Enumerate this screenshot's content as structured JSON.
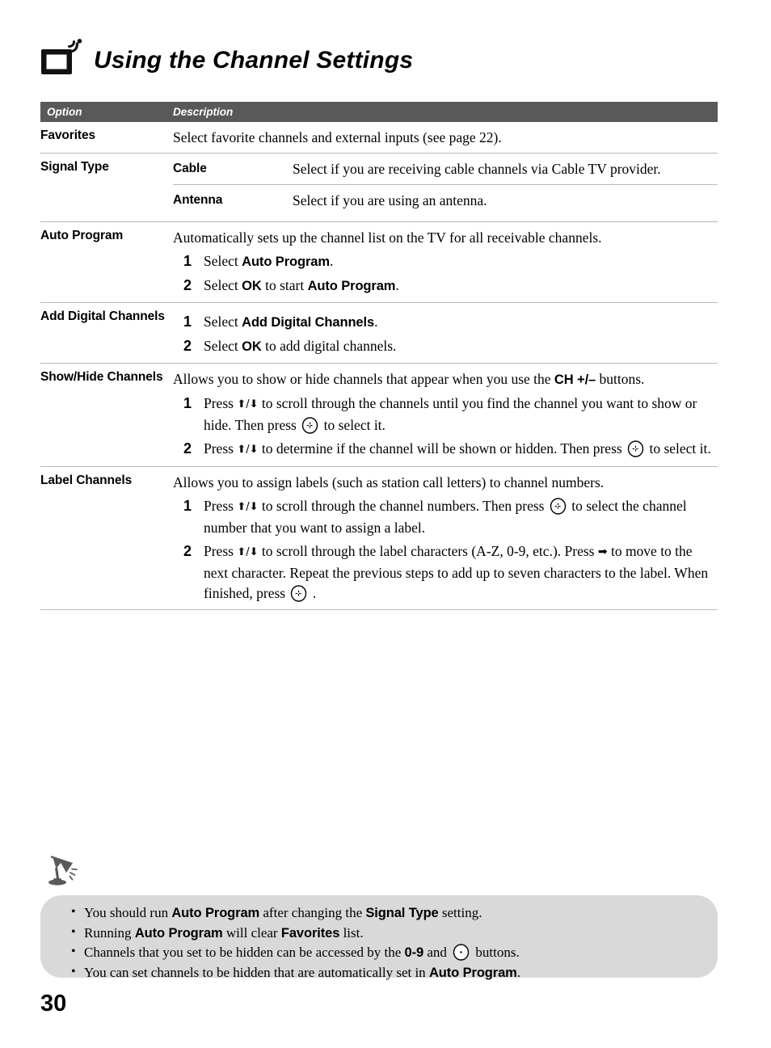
{
  "header": {
    "icon": "tv-signal-icon",
    "title": "Using the Channel Settings"
  },
  "table": {
    "columns": {
      "option": "Option",
      "description": "Description"
    },
    "rows": [
      {
        "option": "Favorites",
        "description": "Select favorite channels and external inputs (see page 22)."
      },
      {
        "option": "Signal Type",
        "subrows": [
          {
            "label": "Cable",
            "description": "Select if you are receiving cable channels via Cable TV provider."
          },
          {
            "label": "Antenna",
            "description": "Select if you are using an antenna."
          }
        ]
      },
      {
        "option": "Auto Program",
        "lead": "Automatically sets up the channel list on the TV for all receivable channels.",
        "steps": [
          {
            "num": "1",
            "text_a": "Select ",
            "bold_a": "Auto Program",
            "text_b": "."
          },
          {
            "num": "2",
            "text_a": "Select ",
            "bold_a": "OK",
            "text_b": " to start ",
            "bold_b": "Auto Program",
            "text_c": "."
          }
        ]
      },
      {
        "option": "Add Digital Channels",
        "steps": [
          {
            "num": "1",
            "text_a": "Select ",
            "bold_a": "Add Digital Channels",
            "text_b": "."
          },
          {
            "num": "2",
            "text_a": "Select ",
            "bold_a": "OK",
            "text_b": " to add digital channels."
          }
        ]
      },
      {
        "option": "Show/Hide Channels",
        "lead_a": "Allows you to show or hide channels that appear when you use the ",
        "lead_bold": "CH +/–",
        "lead_b": " buttons.",
        "steps": [
          {
            "num": "1",
            "seg1": "Press ",
            "arrows": "⬆/⬇",
            "seg2": " to scroll through the channels until you find the channel you want to show or hide. Then press ",
            "icon": "select-button-icon",
            "seg3": " to select it."
          },
          {
            "num": "2",
            "seg1": "Press ",
            "arrows": "⬆/⬇",
            "seg2": " to determine if the channel will be shown or hidden. Then press ",
            "icon": "select-button-icon",
            "seg3": " to select it."
          }
        ]
      },
      {
        "option": "Label Channels",
        "lead": "Allows you to assign labels (such as station call letters) to channel numbers.",
        "steps": [
          {
            "num": "1",
            "seg1": "Press ",
            "arrows": "⬆/⬇",
            "seg2": " to scroll through the channel numbers. Then press ",
            "icon": "select-button-icon",
            "seg3": " to select the channel number that you want to assign a label."
          },
          {
            "num": "2",
            "seg1": "Press ",
            "arrows": "⬆/⬇",
            "seg2": " to scroll through the label characters (A-Z, 0-9, etc.). Press ",
            "arrow_right": "➡",
            "seg3": " to move to the next character. Repeat the previous steps to add up to seven characters to the label. When finished, press ",
            "icon": "select-button-icon",
            "seg4": " ."
          }
        ]
      }
    ]
  },
  "notes": {
    "icon": "desk-lamp-tip-icon",
    "background_color": "#d9d9d9",
    "items": [
      {
        "seg1": "You should run ",
        "bold1": "Auto Program",
        "seg2": " after changing the ",
        "bold2": "Signal Type",
        "seg3": " setting."
      },
      {
        "seg1": "Running ",
        "bold1": "Auto Program",
        "seg2": " will clear ",
        "bold2": "Favorites",
        "seg3": " list."
      },
      {
        "seg1": "Channels that you set to be hidden can be accessed by the ",
        "bold1": "0-9",
        "seg2": " and ",
        "icon": "dot-button-icon",
        "seg3": " buttons."
      },
      {
        "seg1": "You can set channels to be hidden that are automatically set in ",
        "bold1": "Auto Program",
        "seg2": "."
      }
    ]
  },
  "footer": {
    "page_number": "30"
  },
  "colors": {
    "table_header_bg": "#59595b",
    "table_header_text": "#ffffff",
    "rule": "#b9b9b9",
    "notes_bg": "#d9d9d9",
    "text": "#000000"
  }
}
